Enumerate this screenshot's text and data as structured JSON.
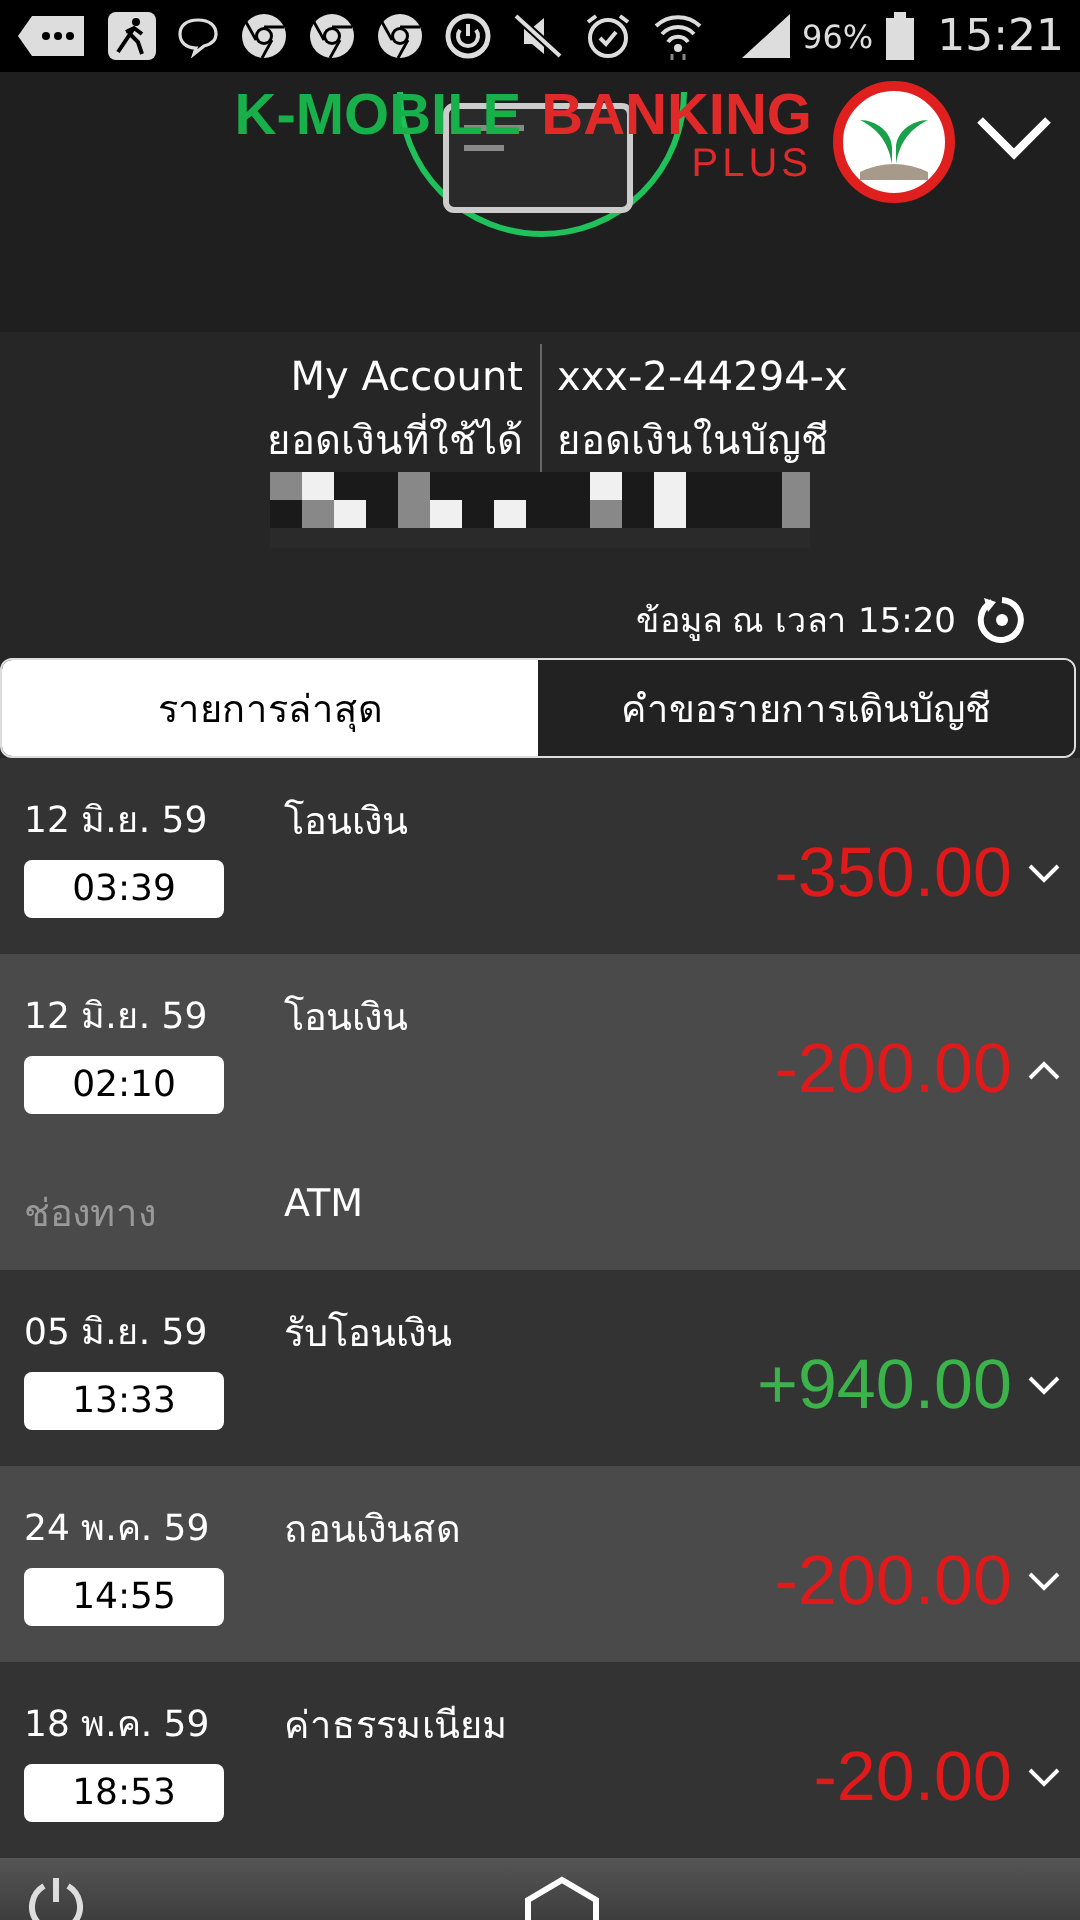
{
  "status_bar": {
    "battery": "96%",
    "time": "15:21"
  },
  "header": {
    "logo_left": "K-MOBILE",
    "logo_right": "BANKING",
    "logo_sub": "PLUS"
  },
  "account": {
    "name": "My Account",
    "number": "xxx-2-44294-x",
    "available_label": "ยอดเงินที่ใช้ได้",
    "ledger_label": "ยอดเงินในบัญชี"
  },
  "updated": {
    "label": "ข้อมูล ณ เวลา",
    "time": "15:20"
  },
  "tabs": [
    {
      "label": "รายการล่าสุด",
      "selected": true
    },
    {
      "label": "คำขอรายการเดินบัญชี",
      "selected": false
    }
  ],
  "transactions": [
    {
      "date": "12 มิ.ย. 59",
      "time": "03:39",
      "description": "โอนเงิน",
      "amount": "-350.00",
      "kind": "debit",
      "expanded": false
    },
    {
      "date": "12 มิ.ย. 59",
      "time": "02:10",
      "description": "โอนเงิน",
      "amount": "-200.00",
      "kind": "debit",
      "expanded": true,
      "detail": {
        "label": "ช่องทาง",
        "value": "ATM"
      }
    },
    {
      "date": "05 มิ.ย. 59",
      "time": "13:33",
      "description": "รับโอนเงิน",
      "amount": "+940.00",
      "kind": "credit",
      "expanded": false
    },
    {
      "date": "24 พ.ค. 59",
      "time": "14:55",
      "description": "ถอนเงินสด",
      "amount": "-200.00",
      "kind": "debit",
      "expanded": false
    },
    {
      "date": "18 พ.ค. 59",
      "time": "18:53",
      "description": "ค่าธรรมเนียม",
      "amount": "-20.00",
      "kind": "debit",
      "expanded": false
    }
  ]
}
